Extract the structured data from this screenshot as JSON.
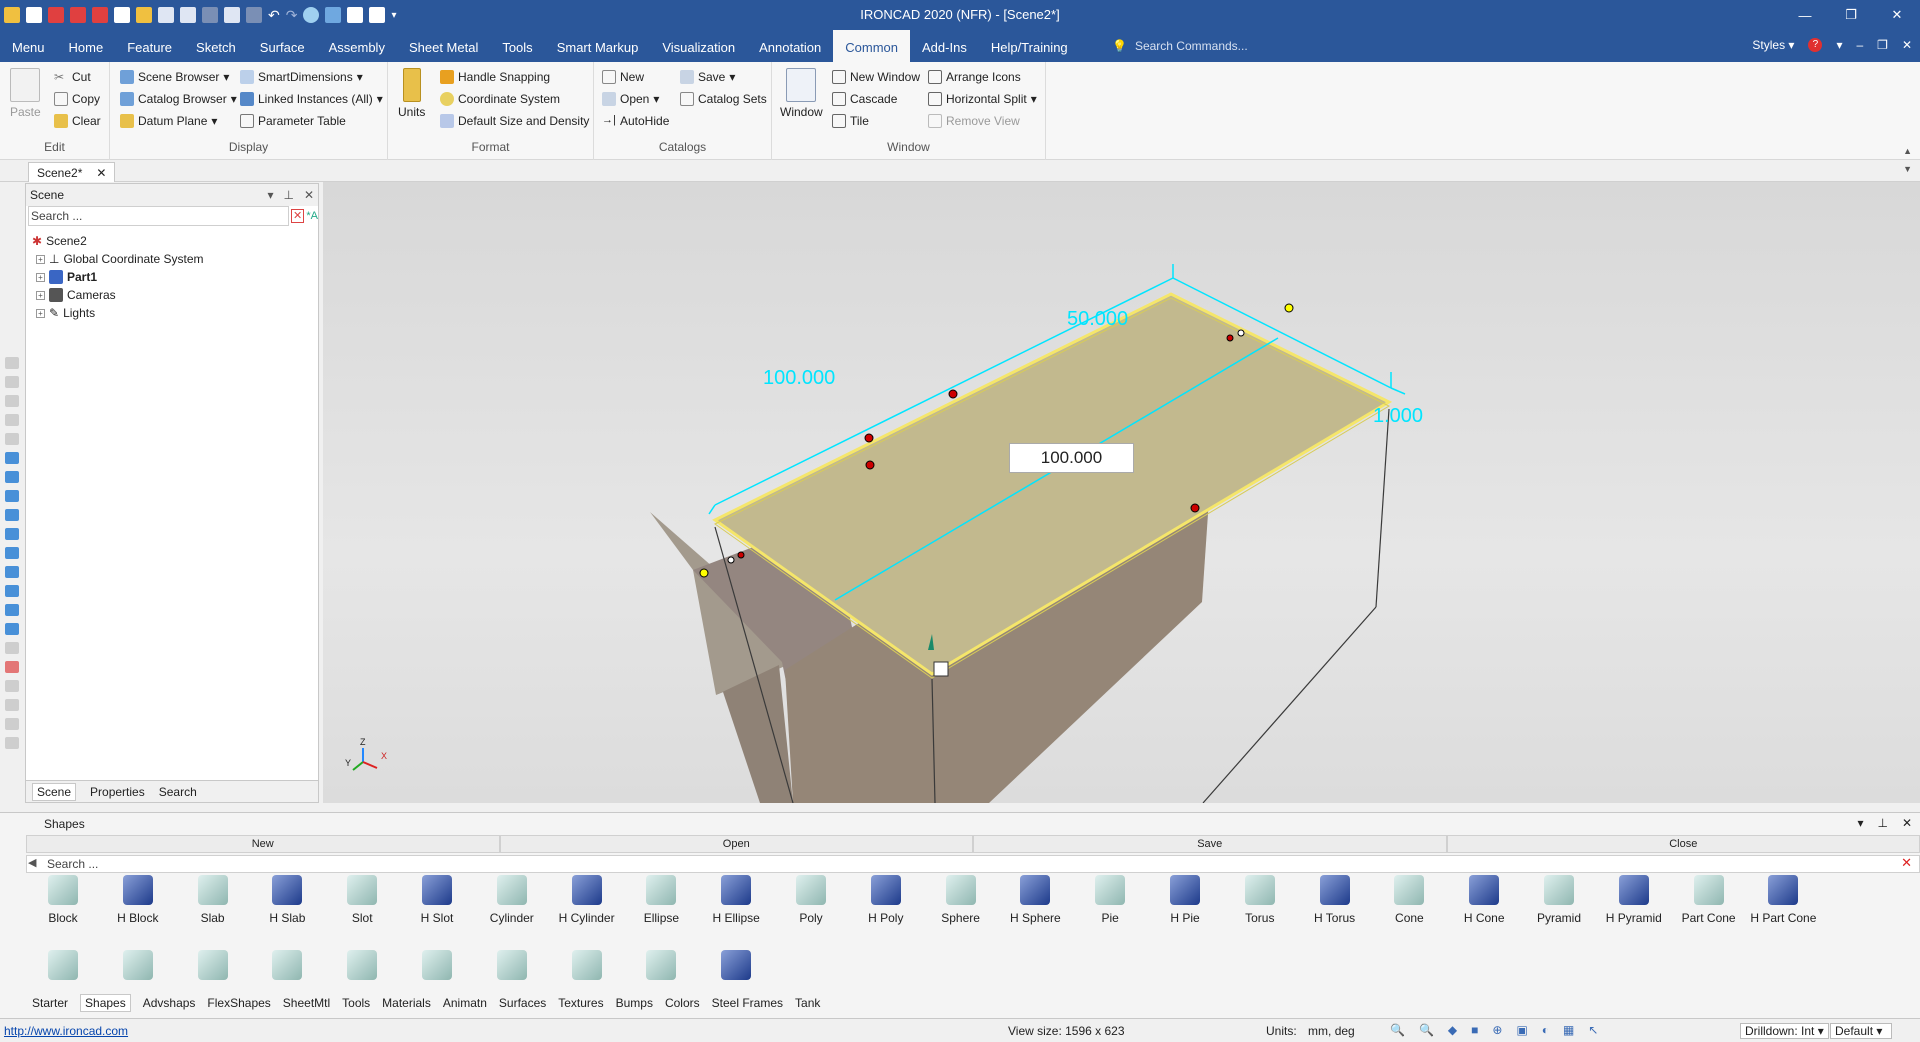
{
  "app": {
    "title": "IRONCAD 2020 (NFR) - [Scene2*]"
  },
  "menu": {
    "tabs": [
      "Menu",
      "Home",
      "Feature",
      "Sketch",
      "Surface",
      "Assembly",
      "Sheet Metal",
      "Tools",
      "Smart Markup",
      "Visualization",
      "Annotation",
      "Common",
      "Add-Ins",
      "Help/Training"
    ],
    "active": "Common",
    "search_placeholder": "Search Commands...",
    "styles_label": "Styles"
  },
  "ribbon": {
    "edit": {
      "paste": "Paste",
      "cut": "Cut",
      "copy": "Copy",
      "clear": "Clear",
      "label": "Edit"
    },
    "display": {
      "scene_browser": "Scene Browser",
      "catalog_browser": "Catalog Browser",
      "datum_plane": "Datum Plane",
      "smart_dimensions": "SmartDimensions",
      "linked_instances": "Linked Instances (All)",
      "parameter_table": "Parameter Table",
      "label": "Display"
    },
    "format": {
      "units": "Units",
      "handle_snapping": "Handle Snapping",
      "coordinate_system": "Coordinate System",
      "default_size": "Default Size and Density",
      "label": "Format"
    },
    "catalogs": {
      "new": "New",
      "open": "Open",
      "autohide": "AutoHide",
      "save": "Save",
      "catalog_sets": "Catalog Sets",
      "label": "Catalogs"
    },
    "window": {
      "window": "Window",
      "new_window": "New Window",
      "cascade": "Cascade",
      "tile": "Tile",
      "arrange_icons": "Arrange Icons",
      "horizontal_split": "Horizontal Split",
      "remove_view": "Remove View",
      "label": "Window"
    }
  },
  "doc_tab": {
    "label": "Scene2*"
  },
  "scene_panel": {
    "title": "Scene",
    "search_placeholder": "Search ...",
    "root": "Scene2",
    "items": [
      "Global Coordinate System",
      "Part1",
      "Cameras",
      "Lights"
    ],
    "bottom_tabs": [
      "Scene",
      "Properties",
      "Search"
    ]
  },
  "viewport": {
    "dim_length": "100.000",
    "dim_width": "50.000",
    "dim_thickness": "1.000",
    "dim_edit_value": "100.000",
    "axis_labels": [
      "Z",
      "Y",
      "X"
    ],
    "colors": {
      "face": "#c2b98e",
      "side": "#9a8c82",
      "dims": "#00e5ff",
      "edge": "#f5e66a"
    }
  },
  "shapes_panel": {
    "title": "Shapes",
    "buttons": [
      "New",
      "Open",
      "Save",
      "Close"
    ],
    "search_placeholder": "Search ...",
    "items": [
      "Block",
      "H Block",
      "Slab",
      "H Slab",
      "Slot",
      "H Slot",
      "Cylinder",
      "H Cylinder",
      "Ellipse",
      "H Ellipse",
      "Poly",
      "H Poly",
      "Sphere",
      "H Sphere",
      "Pie",
      "H Pie",
      "Torus",
      "H Torus",
      "Cone",
      "H Cone",
      "Pyramid",
      "H Pyramid",
      "Part Cone",
      "H Part Cone"
    ],
    "bottom_tabs": [
      "Starter",
      "Shapes",
      "Advshaps",
      "FlexShapes",
      "SheetMtl",
      "Tools",
      "Materials",
      "Animatn",
      "Surfaces",
      "Textures",
      "Bumps",
      "Colors",
      "Steel Frames",
      "Tank"
    ],
    "active_tab": "Shapes"
  },
  "status": {
    "url": "http://www.ironcad.com",
    "view_size": "View size: 1596 x  623",
    "units_label": "Units:",
    "units_value": "mm, deg",
    "drilldown": "Drilldown: Int",
    "default": "Default"
  }
}
